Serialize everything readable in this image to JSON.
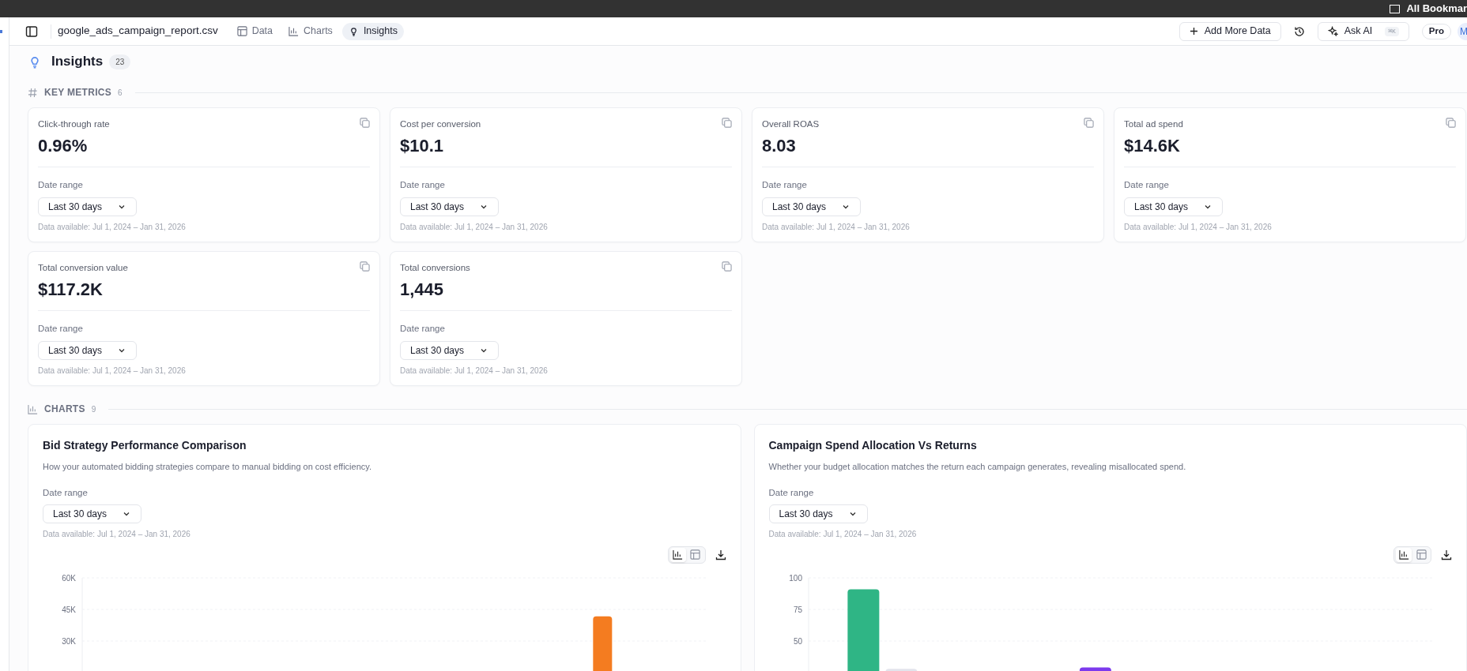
{
  "browser_bar": {
    "bookmarks": "All Bookmar"
  },
  "header": {
    "file_name": "google_ads_campaign_report.csv",
    "tabs": [
      {
        "label": "Data",
        "kind": "table",
        "selected": false
      },
      {
        "label": "Charts",
        "kind": "chart",
        "selected": false
      },
      {
        "label": "Insights",
        "kind": "bulb",
        "selected": true
      }
    ],
    "add_button": "Add More Data",
    "ask_ai": {
      "label": "Ask AI",
      "shortcut": "⌘K"
    },
    "plan": "Pro",
    "avatar": "M"
  },
  "insights": {
    "title": "Insights",
    "count": "23"
  },
  "key_metrics": {
    "title": "KEY METRICS",
    "count": "6",
    "cards": [
      {
        "label": "Click-through rate",
        "value": "0.96%",
        "date_range_label": "Date range",
        "date_range": "Last 30 days",
        "data_available": "Data available: Jul 1, 2024 – Jan 31, 2026"
      },
      {
        "label": "Cost per conversion",
        "value": "$10.1",
        "date_range_label": "Date range",
        "date_range": "Last 30 days",
        "data_available": "Data available: Jul 1, 2024 – Jan 31, 2026"
      },
      {
        "label": "Overall ROAS",
        "value": "8.03",
        "date_range_label": "Date range",
        "date_range": "Last 30 days",
        "data_available": "Data available: Jul 1, 2024 – Jan 31, 2026"
      },
      {
        "label": "Total ad spend",
        "value": "$14.6K",
        "date_range_label": "Date range",
        "date_range": "Last 30 days",
        "data_available": "Data available: Jul 1, 2024 – Jan 31, 2026"
      },
      {
        "label": "Total conversion value",
        "value": "$117.2K",
        "date_range_label": "Date range",
        "date_range": "Last 30 days",
        "data_available": "Data available: Jul 1, 2024 – Jan 31, 2026"
      },
      {
        "label": "Total conversions",
        "value": "1,445",
        "date_range_label": "Date range",
        "date_range": "Last 30 days",
        "data_available": "Data available: Jul 1, 2024 – Jan 31, 2026"
      }
    ]
  },
  "charts": {
    "title": "CHARTS",
    "count": "9",
    "cards": [
      {
        "title": "Bid Strategy Performance Comparison",
        "description": "How your automated bidding strategies compare to manual bidding on cost efficiency.",
        "date_range_label": "Date range",
        "date_range": "Last 30 days",
        "data_available": "Data available: Jul 1, 2024 – Jan 31, 2026",
        "chart_data": {
          "type": "bar",
          "ylim": [
            0,
            60000
          ],
          "yticks": [
            {
              "value": 60000,
              "label": "60K"
            },
            {
              "value": 45000,
              "label": "45K"
            },
            {
              "value": 30000,
              "label": "30K"
            }
          ],
          "series": [
            {
              "color": "#f47c20",
              "values": [
                null,
                null,
                null,
                null,
                null,
                null,
                null,
                41700,
                null
              ]
            }
          ]
        },
        "view_options": [
          {
            "kind": "chart",
            "selected": true
          },
          {
            "kind": "table",
            "selected": false
          }
        ]
      },
      {
        "title": "Campaign Spend Allocation Vs Returns",
        "description": "Whether your budget allocation matches the return each campaign generates, revealing misallocated spend.",
        "date_range_label": "Date range",
        "date_range": "Last 30 days",
        "data_available": "Data available: Jul 1, 2024 – Jan 31, 2026",
        "chart_data": {
          "type": "bar",
          "ylim": [
            0,
            100
          ],
          "yticks": [
            100,
            75,
            50
          ],
          "series": [
            {
              "color": "#2fb585",
              "values": [
                91,
                null,
                null,
                null
              ]
            },
            {
              "color": "#e2e4ec",
              "values": [
                28,
                null,
                null,
                null
              ]
            },
            {
              "color": "#7c3aed",
              "values": [
                null,
                29,
                null,
                null
              ]
            }
          ]
        },
        "view_options": [
          {
            "kind": "chart",
            "selected": true
          },
          {
            "kind": "table",
            "selected": false
          }
        ]
      }
    ]
  }
}
